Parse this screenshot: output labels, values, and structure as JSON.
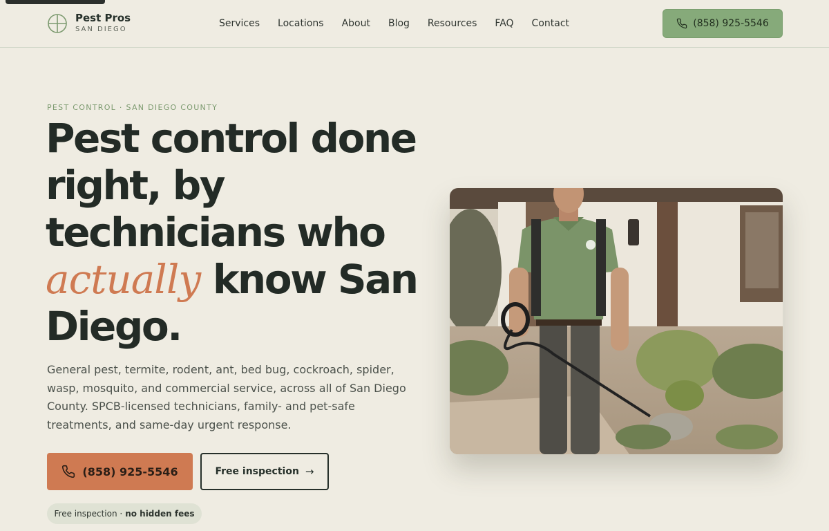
{
  "header": {
    "logo": {
      "name": "Pest Pros",
      "sub": "SAN DIEGO"
    },
    "nav": [
      "Services",
      "Locations",
      "About",
      "Blog",
      "Resources",
      "FAQ",
      "Contact"
    ],
    "phone_label": "(858) 925-5546"
  },
  "hero": {
    "eyebrow": "PEST CONTROL · SAN DIEGO COUNTY",
    "headline_part1": "Pest control done right, by technicians who ",
    "headline_accent": "actually",
    "headline_part2": " know San Diego.",
    "lead": "General pest, termite, rodent, ant, bed bug, cockroach, spider, wasp, mosquito, and commercial service, across all of San Diego County. SPCB-licensed technicians, family- and pet-safe treatments, and same-day urgent response.",
    "primary_cta": "(858) 925-5546",
    "secondary_cta": "Free inspection",
    "badge_light": "Free inspection ·",
    "badge_bold": "no hidden fees"
  },
  "colors": {
    "background": "#efece2",
    "accent_green": "#86aa7a",
    "accent_terracotta": "#cf7a52",
    "text_dark": "#232b26"
  },
  "icons": [
    "logo-crosshair-icon",
    "phone-icon",
    "arrow-right-icon"
  ]
}
